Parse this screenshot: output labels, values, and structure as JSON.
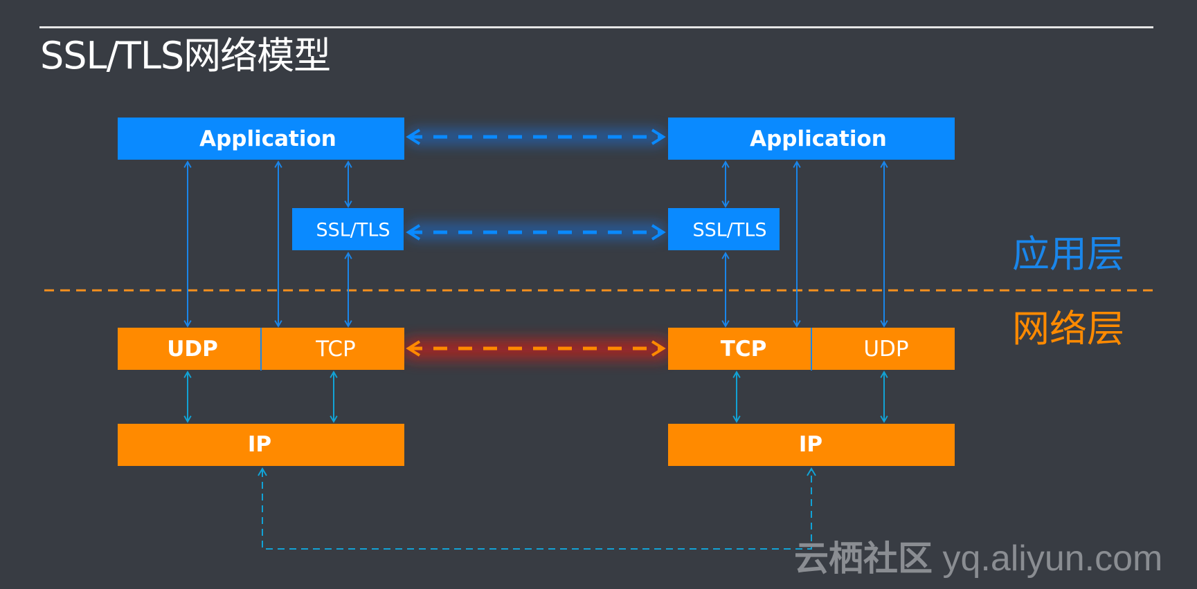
{
  "title": "SSL/TLS网络模型",
  "colors": {
    "background": "#383c43",
    "app_blue": "#0a8aff",
    "net_orange": "#ff8a00",
    "link_blue": "#1a86ea",
    "link_cyan": "#12a3d6",
    "glow_blue": "#1d6fd6",
    "glow_red": "#c0201e",
    "divider_orange": "#f5901e"
  },
  "layer_labels": {
    "application": "应用层",
    "network": "网络层"
  },
  "left_stack": {
    "application": "Application",
    "ssl_tls": "SSL/TLS",
    "udp": "UDP",
    "tcp": "TCP",
    "ip": "IP"
  },
  "right_stack": {
    "application": "Application",
    "ssl_tls": "SSL/TLS",
    "tcp": "TCP",
    "udp": "UDP",
    "ip": "IP"
  },
  "peer_links": [
    {
      "name": "application-peer-link",
      "from": "Application",
      "to": "Application",
      "style": "dashed-blue-glow"
    },
    {
      "name": "ssl-tls-peer-link",
      "from": "SSL/TLS",
      "to": "SSL/TLS",
      "style": "dashed-blue-glow"
    },
    {
      "name": "tcp-peer-link",
      "from": "TCP",
      "to": "TCP",
      "style": "dashed-orange-red-glow"
    },
    {
      "name": "ip-physical-link",
      "from": "IP",
      "to": "IP",
      "style": "dashed-cyan"
    }
  ],
  "watermark": {
    "cn": "云栖社区",
    "url": "yq.aliyun.com"
  }
}
